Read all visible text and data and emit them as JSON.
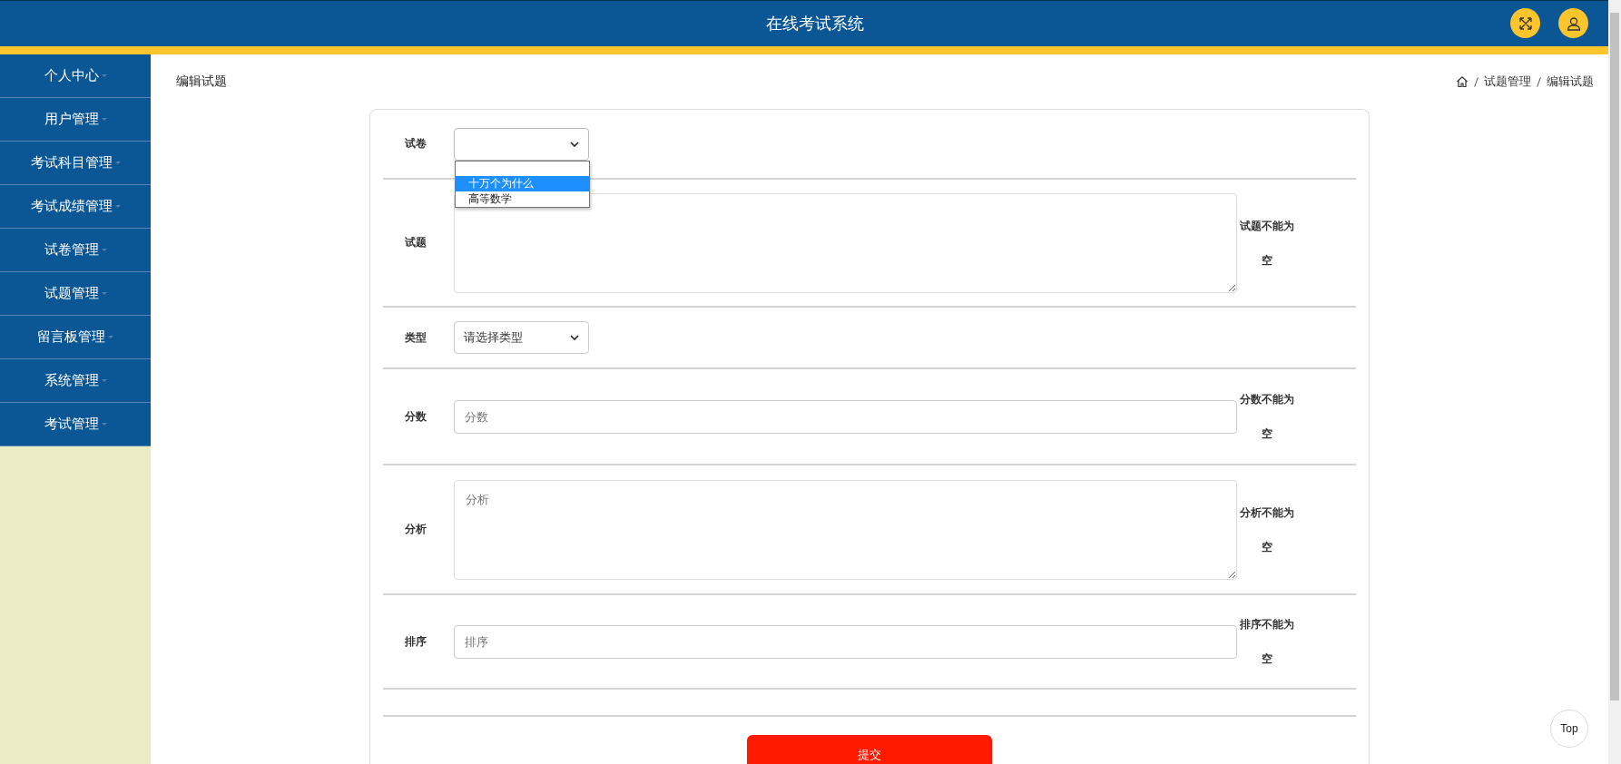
{
  "header": {
    "title": "在线考试系统"
  },
  "sidebar": {
    "items": [
      {
        "label": "个人中心"
      },
      {
        "label": "用户管理"
      },
      {
        "label": "考试科目管理"
      },
      {
        "label": "考试成绩管理"
      },
      {
        "label": "试卷管理"
      },
      {
        "label": "试题管理"
      },
      {
        "label": "留言板管理"
      },
      {
        "label": "系统管理"
      },
      {
        "label": "考试管理"
      }
    ]
  },
  "page_title": "编辑试题",
  "breadcrumb": [
    "试题管理",
    "编辑试题"
  ],
  "form": {
    "fields": [
      {
        "kind": "select",
        "label": "试卷",
        "open": true,
        "options": [
          {
            "label": "十万个为什么",
            "selected": true
          },
          {
            "label": "高等数学",
            "selected": false
          }
        ]
      },
      {
        "kind": "textarea",
        "label": "试题",
        "error": "试题不能为空"
      },
      {
        "kind": "select",
        "label": "类型",
        "value": "请选择类型",
        "open": false
      },
      {
        "kind": "input",
        "label": "分数",
        "placeholder": "分数",
        "error": "分数不能为空"
      },
      {
        "kind": "textarea",
        "label": "分析",
        "placeholder": "分析",
        "error": "分析不能为空"
      },
      {
        "kind": "input",
        "label": "排序",
        "placeholder": "排序",
        "error": "排序不能为空"
      }
    ],
    "submit": "提交"
  },
  "top_button": "Top"
}
